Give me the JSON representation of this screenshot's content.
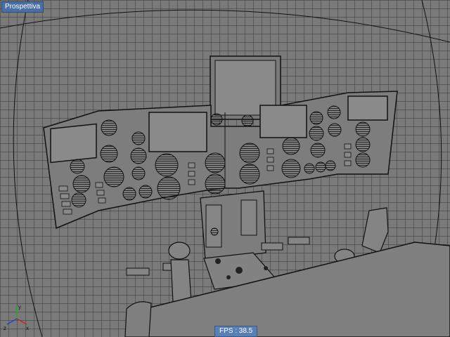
{
  "viewport": {
    "label": "Prospettiva",
    "fps_label": "FPS : 38.5"
  },
  "axis_gizmo": {
    "x_label": "x",
    "y_label": "y",
    "z_label": "z",
    "x_color": "#cc2222",
    "y_color": "#22aa22",
    "z_color": "#2244cc"
  },
  "colors": {
    "background": "#7a7a7a",
    "mesh_line": "#000000",
    "label_bg": "#4a6fa5",
    "fps_bg": "#5a7fb5"
  }
}
